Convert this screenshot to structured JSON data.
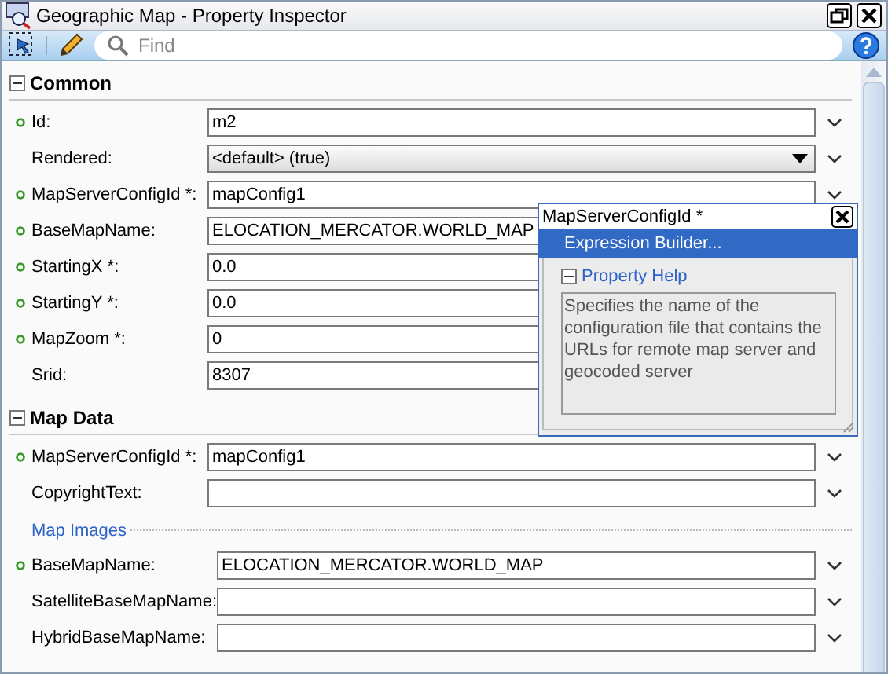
{
  "window": {
    "title": "Geographic Map - Property Inspector"
  },
  "toolbar": {
    "search": {
      "placeholder": "Find"
    }
  },
  "sections": [
    {
      "title": "Common",
      "expanded": true,
      "groups": [
        {
          "rows": [
            {
              "label": "Id:",
              "set": true,
              "kind": "text",
              "value": "m2"
            },
            {
              "label": "Rendered:",
              "set": false,
              "kind": "dropdown",
              "value": "<default> (true)"
            },
            {
              "label": "MapServerConfigId *:",
              "set": true,
              "kind": "text",
              "value": "mapConfig1"
            },
            {
              "label": "BaseMapName:",
              "set": true,
              "kind": "text",
              "value": "ELOCATION_MERCATOR.WORLD_MAP"
            },
            {
              "label": "StartingX *:",
              "set": true,
              "kind": "text",
              "value": "0.0"
            },
            {
              "label": "StartingY *:",
              "set": true,
              "kind": "text",
              "value": "0.0"
            },
            {
              "label": "MapZoom *:",
              "set": true,
              "kind": "text",
              "value": "0"
            },
            {
              "label": "Srid:",
              "set": false,
              "kind": "text",
              "value": "8307"
            }
          ]
        }
      ]
    },
    {
      "title": "Map Data",
      "expanded": true,
      "groups": [
        {
          "rows": [
            {
              "label": "MapServerConfigId *:",
              "set": true,
              "kind": "text",
              "value": "mapConfig1"
            },
            {
              "label": "CopyrightText:",
              "set": false,
              "kind": "text"
            }
          ]
        },
        {
          "title": "Map Images",
          "rows": [
            {
              "label": "BaseMapName:",
              "set": true,
              "kind": "text",
              "value": "ELOCATION_MERCATOR.WORLD_MAP"
            },
            {
              "label": "SatelliteBaseMapName:",
              "set": false,
              "kind": "text"
            },
            {
              "label": "HybridBaseMapName:",
              "set": false,
              "kind": "text"
            }
          ]
        }
      ]
    }
  ],
  "popup": {
    "title": "MapServerConfigId *",
    "menu_item": "Expression Builder...",
    "help": {
      "title": "Property Help",
      "expanded": true,
      "text": "Specifies the name of the configuration file that contains the URLs for remote map server and geocoded server"
    }
  }
}
